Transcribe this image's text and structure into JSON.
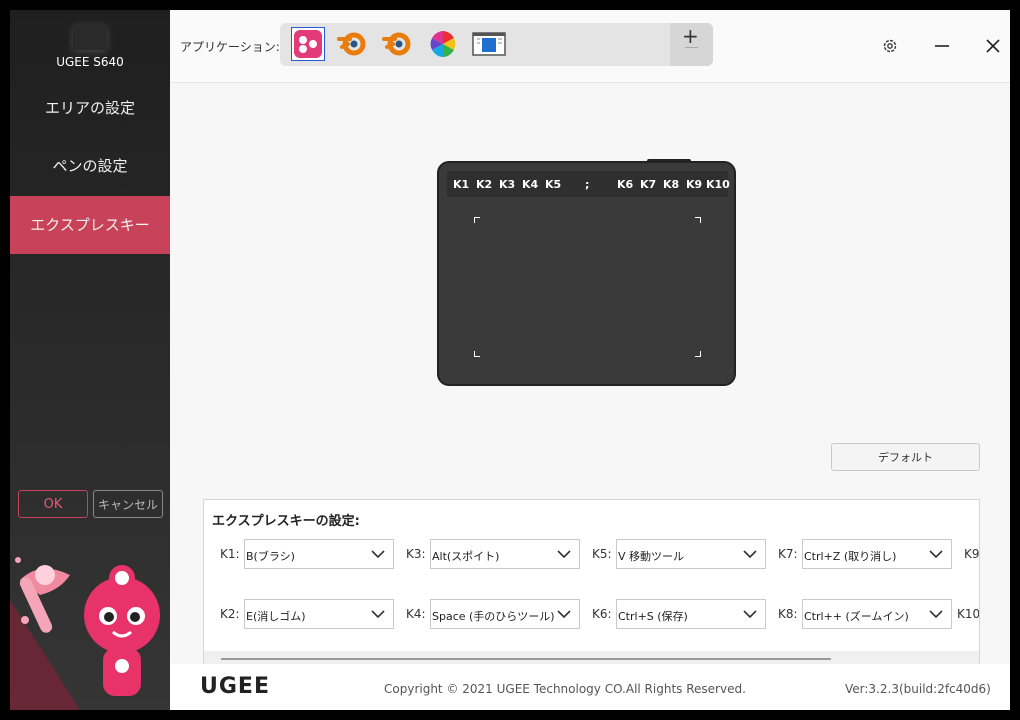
{
  "sidebar": {
    "device_name": "UGEE S640",
    "items": [
      {
        "label": "エリアの設定",
        "active": false
      },
      {
        "label": "ペンの設定",
        "active": false
      },
      {
        "label": "エクスプレスキー",
        "active": true
      }
    ],
    "ok_label": "OK",
    "cancel_label": "キャンセル"
  },
  "topbar": {
    "app_label": "アプリケーション:",
    "apps": [
      {
        "icon": "pink-app-icon",
        "selected": true
      },
      {
        "icon": "blender-icon",
        "selected": false
      },
      {
        "icon": "blender-icon",
        "selected": false
      },
      {
        "icon": "color-wheel-icon",
        "selected": false
      },
      {
        "icon": "window-app-icon",
        "selected": false
      }
    ],
    "add_label": "+"
  },
  "tablet": {
    "keys_left": [
      "K1",
      "K2",
      "K3",
      "K4",
      "K5"
    ],
    "separator": ";",
    "keys_right": [
      "K6",
      "K7",
      "K8",
      "K9",
      "K10"
    ]
  },
  "default_button": "デフォルト",
  "settings": {
    "title": "エクスプレスキーの設定:",
    "keys": [
      {
        "label": "K1:",
        "value": "B(ブラシ)"
      },
      {
        "label": "K3:",
        "value": "Alt(スポイト)"
      },
      {
        "label": "K5:",
        "value": "V 移動ツール"
      },
      {
        "label": "K7:",
        "value": "Ctrl+Z (取り消し)"
      },
      {
        "label": "K9",
        "value": ""
      },
      {
        "label": "K2:",
        "value": "E(消しゴム)"
      },
      {
        "label": "K4:",
        "value": "Space (手のひらツール)"
      },
      {
        "label": "K6:",
        "value": "Ctrl+S (保存)"
      },
      {
        "label": "K8:",
        "value": "Ctrl++ (ズームイン)"
      },
      {
        "label": "K10",
        "value": ""
      }
    ]
  },
  "footer": {
    "logo": "UGEE",
    "copyright": "Copyright © 2021 UGEE Technology CO.All Rights Reserved.",
    "version": "Ver:3.2.3(build:2fc40d6)"
  },
  "colors": {
    "accent": "#c8425a",
    "sidebar": "#2a2a2a"
  }
}
